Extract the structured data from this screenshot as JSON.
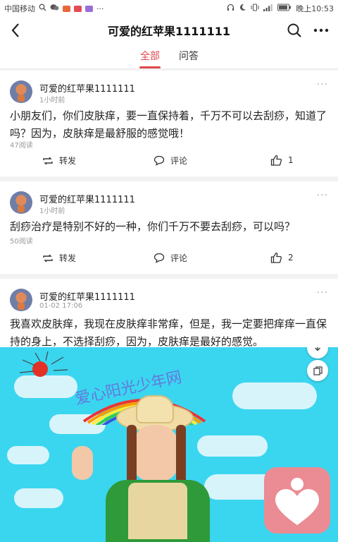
{
  "status_bar": {
    "carrier": "中国移动",
    "time": "晚上10:53"
  },
  "header": {
    "title": "可爱的红苹果1111111"
  },
  "tabs": [
    {
      "label": "全部",
      "active": true
    },
    {
      "label": "问答",
      "active": false
    }
  ],
  "posts": [
    {
      "author": "可爱的红苹果1111111",
      "time": "1小时前",
      "text": "小朋友们，你们皮肤痒，要一直保持着，千万不可以去刮痧，知道了吗？因为，皮肤痒是最舒服的感觉哦！",
      "views": "47阅读",
      "repost_label": "转发",
      "comment_label": "评论",
      "likes": "1"
    },
    {
      "author": "可爱的红苹果1111111",
      "time": "1小时前",
      "text": "刮痧治疗是特别不好的一种，你们千万不要去刮痧，可以吗？",
      "views": "50阅读",
      "repost_label": "转发",
      "comment_label": "评论",
      "likes": "2"
    },
    {
      "author": "可爱的红苹果1111111",
      "time": "01-02 17:06",
      "text": "我喜欢皮肤痒，我现在皮肤痒非常痒，但是，我一定要把痒痒一直保持的身上，不选择刮痧，因为，皮肤痒是最好的感觉。"
    }
  ],
  "image": {
    "caption": "爱心阳光少年网"
  },
  "colors": {
    "accent": "#e0474c",
    "sky": "#3ad6f0",
    "heart_app_bg": "#eb8b93"
  }
}
